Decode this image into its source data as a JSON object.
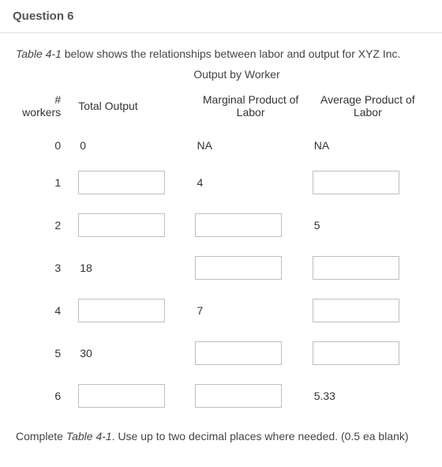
{
  "question_title": "Question 6",
  "intro_prefix": "Table 4-1",
  "intro_rest": " below shows the relationships between labor and output for XYZ Inc.",
  "table_title": "Output by Worker",
  "headers": {
    "workers": "# workers",
    "total": "Total Output",
    "mpl": "Marginal Product of Labor",
    "apl": "Average Product of Labor"
  },
  "rows": [
    {
      "workers": "0",
      "total": {
        "type": "text",
        "value": "0"
      },
      "mpl": {
        "type": "text",
        "value": "NA"
      },
      "apl": {
        "type": "text",
        "value": "NA"
      }
    },
    {
      "workers": "1",
      "total": {
        "type": "input",
        "value": ""
      },
      "mpl": {
        "type": "text",
        "value": "4"
      },
      "apl": {
        "type": "input",
        "value": ""
      }
    },
    {
      "workers": "2",
      "total": {
        "type": "input",
        "value": ""
      },
      "mpl": {
        "type": "input",
        "value": ""
      },
      "apl": {
        "type": "text",
        "value": "5"
      }
    },
    {
      "workers": "3",
      "total": {
        "type": "text",
        "value": "18"
      },
      "mpl": {
        "type": "input",
        "value": ""
      },
      "apl": {
        "type": "input",
        "value": ""
      }
    },
    {
      "workers": "4",
      "total": {
        "type": "input",
        "value": ""
      },
      "mpl": {
        "type": "text",
        "value": "7"
      },
      "apl": {
        "type": "input",
        "value": ""
      }
    },
    {
      "workers": "5",
      "total": {
        "type": "text",
        "value": "30"
      },
      "mpl": {
        "type": "input",
        "value": ""
      },
      "apl": {
        "type": "input",
        "value": ""
      }
    },
    {
      "workers": "6",
      "total": {
        "type": "input",
        "value": ""
      },
      "mpl": {
        "type": "input",
        "value": ""
      },
      "apl": {
        "type": "text",
        "value": "5.33"
      }
    }
  ],
  "footer_prefix": "Complete ",
  "footer_em": "Table 4-1",
  "footer_rest": ". Use up to two decimal places where needed. (0.5 ea blank)"
}
